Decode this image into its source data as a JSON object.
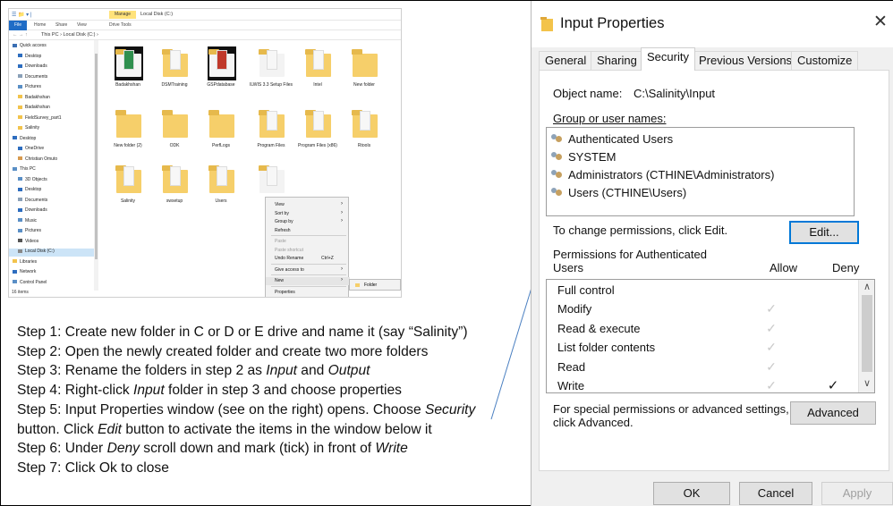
{
  "explorer": {
    "quick_access_label": "☰ 📁 ▾ |",
    "manage_tab": "Manage",
    "window_title": "Local Disk (C:)",
    "ribbon": {
      "file": "File",
      "home": "Home",
      "share": "Share",
      "view": "View",
      "drive_tools": "Drive Tools"
    },
    "address": {
      "nav": "← → ↑",
      "path": "This PC  ›  Local Disk (C:)  ›"
    },
    "nav_items": [
      {
        "label": "Quick access",
        "color": "#3a6fb3"
      },
      {
        "label": "Desktop",
        "color": "#2d6dbf"
      },
      {
        "label": "Downloads",
        "color": "#2d6dbf"
      },
      {
        "label": "Documents",
        "color": "#8aa0b8"
      },
      {
        "label": "Pictures",
        "color": "#5a8fc6"
      },
      {
        "label": "Badakhshan",
        "color": "#f2c34c"
      },
      {
        "label": "Badakhshan",
        "color": "#f2c34c"
      },
      {
        "label": "FieldSurvey_part1",
        "color": "#f2c34c"
      },
      {
        "label": "Salinity",
        "color": "#f2c34c"
      },
      {
        "label": "Desktop",
        "color": "#2d6dbf"
      },
      {
        "label": "OneDrive",
        "color": "#2d6dbf"
      },
      {
        "label": "Christian Omuto",
        "color": "#d79a4f"
      },
      {
        "label": "This PC",
        "color": "#5a8fc6"
      },
      {
        "label": "3D Objects",
        "color": "#5a8fc6"
      },
      {
        "label": "Desktop",
        "color": "#2d6dbf"
      },
      {
        "label": "Documents",
        "color": "#8aa0b8"
      },
      {
        "label": "Downloads",
        "color": "#2d6dbf"
      },
      {
        "label": "Music",
        "color": "#5a8fc6"
      },
      {
        "label": "Pictures",
        "color": "#5a8fc6"
      },
      {
        "label": "Videos",
        "color": "#555555"
      },
      {
        "label": "Local Disk (C:)",
        "color": "#888888"
      },
      {
        "label": "Libraries",
        "color": "#f2c34c"
      },
      {
        "label": "Network",
        "color": "#2d6dbf"
      },
      {
        "label": "Control Panel",
        "color": "#5a8fc6"
      }
    ],
    "status": "16 items",
    "files": [
      {
        "label": "Badakhshan",
        "kind": "image-dark"
      },
      {
        "label": "DSMTraining",
        "kind": "folder"
      },
      {
        "label": "GSPdatabase",
        "kind": "image-dark"
      },
      {
        "label": "ILWIS 3.3 Setup Files",
        "kind": "folder-light"
      },
      {
        "label": "Intel",
        "kind": "folder"
      },
      {
        "label": "New folder",
        "kind": "folder-plain"
      },
      {
        "label": "New folder (2)",
        "kind": "folder-plain"
      },
      {
        "label": "ODK",
        "kind": "folder-plain"
      },
      {
        "label": "PerfLogs",
        "kind": "folder-plain"
      },
      {
        "label": "Program Files",
        "kind": "folder"
      },
      {
        "label": "Program Files (x86)",
        "kind": "folder"
      },
      {
        "label": "Rtools",
        "kind": "folder"
      },
      {
        "label": "Salinity",
        "kind": "folder"
      },
      {
        "label": "swsetup",
        "kind": "folder"
      },
      {
        "label": "Users",
        "kind": "folder"
      },
      {
        "label": "",
        "kind": "folder-light"
      }
    ],
    "context_menu": [
      {
        "label": "View",
        "arrow": "›",
        "disabled": false
      },
      {
        "label": "Sort by",
        "arrow": "›",
        "disabled": false
      },
      {
        "label": "Group by",
        "arrow": "›",
        "disabled": false
      },
      {
        "label": "Refresh",
        "disabled": false
      },
      {
        "label": "Paste",
        "disabled": true
      },
      {
        "label": "Paste shortcut",
        "disabled": true
      },
      {
        "label": "Undo Rename",
        "shortcut": "Ctrl+Z",
        "disabled": false
      },
      {
        "label": "Give access to",
        "arrow": "›",
        "disabled": false
      },
      {
        "label": "New",
        "arrow": "›",
        "disabled": false,
        "highlight": true
      },
      {
        "label": "Properties",
        "disabled": false
      }
    ],
    "submenu_item": "Folder"
  },
  "steps": {
    "s1": {
      "text": "Step 1: Create new folder in C or D or E drive and name it (say “Salinity”)"
    },
    "s2": {
      "text": "Step 2: Open the newly created folder and create two more folders"
    },
    "s3": {
      "pre": "Step 3: Rename the folders in step 2 as ",
      "em1": "Input",
      "mid": " and ",
      "em2": "Output"
    },
    "s4": {
      "pre": "Step 4: Right-click ",
      "em1": "Input",
      "post": " folder in step 3 and choose properties"
    },
    "s5a": {
      "pre": "Step 5: Input Properties window (see on the right) opens. Choose ",
      "em1": "Security"
    },
    "s5b": {
      "pre": "button. Click ",
      "em1": "Edit",
      "post": " button to activate the items in the window below it"
    },
    "s6": {
      "pre": "Step 6: Under ",
      "em1": "Deny",
      "mid": " scroll down and mark (tick) in front of ",
      "em2": "Write"
    },
    "s7": {
      "text": "Step 7: Click Ok to close"
    }
  },
  "dialog": {
    "title": "Input Properties",
    "close_glyph": "✕",
    "tabs": [
      "General",
      "Sharing",
      "Security",
      "Previous Versions",
      "Customize"
    ],
    "active_tab": "Security",
    "object_name_label": "Object name:",
    "object_name_value": "C:\\Salinity\\Input",
    "group_label": "Group or user names:",
    "users": [
      "Authenticated Users",
      "SYSTEM",
      "Administrators (CTHINE\\Administrators)",
      "Users (CTHINE\\Users)"
    ],
    "change_text": "To change permissions, click Edit.",
    "edit_button": "Edit...",
    "perm_label_line1": "Permissions for Authenticated",
    "perm_label_line2": "Users",
    "allow_label": "Allow",
    "deny_label": "Deny",
    "permissions": [
      {
        "name": "Full control",
        "allow": "",
        "deny": ""
      },
      {
        "name": "Modify",
        "allow": "✓",
        "deny": ""
      },
      {
        "name": "Read & execute",
        "allow": "✓",
        "deny": ""
      },
      {
        "name": "List folder contents",
        "allow": "✓",
        "deny": ""
      },
      {
        "name": "Read",
        "allow": "✓",
        "deny": ""
      },
      {
        "name": "Write",
        "allow": "✓",
        "deny": "✓"
      }
    ],
    "scroll_up": "∧",
    "scroll_down": "∨",
    "special_line1": "For special permissions or advanced settings,",
    "special_line2": "click Advanced.",
    "advanced_button": "Advanced",
    "ok_button": "OK",
    "cancel_button": "Cancel",
    "apply_button": "Apply"
  }
}
